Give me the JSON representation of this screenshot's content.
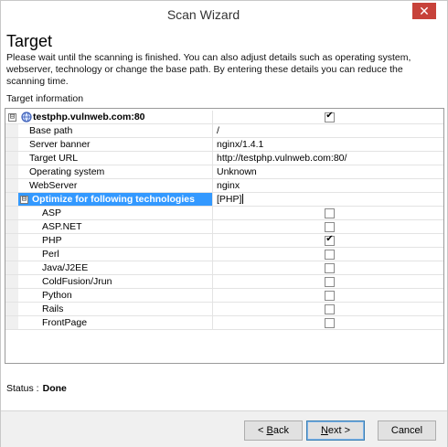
{
  "window": {
    "title": "Scan Wizard",
    "close_glyph": "✕"
  },
  "header": {
    "title": "Target",
    "description": "Please wait until the scanning is finished. You can also adjust details such as operating system, webserver, technology or change the base path. By entering these details you can reduce the scanning time."
  },
  "target_info": {
    "label": "Target information",
    "host": {
      "name": "testphp.vulnweb.com:80",
      "checked": true,
      "icon": "globe-icon",
      "expander": "⊟"
    },
    "properties": [
      {
        "label": "Base path",
        "value": "/"
      },
      {
        "label": "Server banner",
        "value": "nginx/1.4.1"
      },
      {
        "label": "Target URL",
        "value": "http://testphp.vulnweb.com:80/"
      },
      {
        "label": "Operating system",
        "value": "Unknown"
      },
      {
        "label": "WebServer",
        "value": "nginx"
      }
    ],
    "technologies": {
      "label": "Optimize for following technologies",
      "value": "[PHP]",
      "expander": "⊟",
      "items": [
        {
          "label": "ASP",
          "checked": false
        },
        {
          "label": "ASP.NET",
          "checked": false
        },
        {
          "label": "PHP",
          "checked": true
        },
        {
          "label": "Perl",
          "checked": false
        },
        {
          "label": "Java/J2EE",
          "checked": false
        },
        {
          "label": "ColdFusion/Jrun",
          "checked": false
        },
        {
          "label": "Python",
          "checked": false
        },
        {
          "label": "Rails",
          "checked": false
        },
        {
          "label": "FrontPage",
          "checked": false
        }
      ]
    }
  },
  "status": {
    "label": "Status :",
    "value": "Done"
  },
  "buttons": {
    "back_prefix": "< ",
    "back_key": "B",
    "back_rest": "ack",
    "next_key": "N",
    "next_rest": "ext >",
    "cancel": "Cancel"
  },
  "colors": {
    "selection": "#3399ff",
    "close": "#c7423a"
  }
}
